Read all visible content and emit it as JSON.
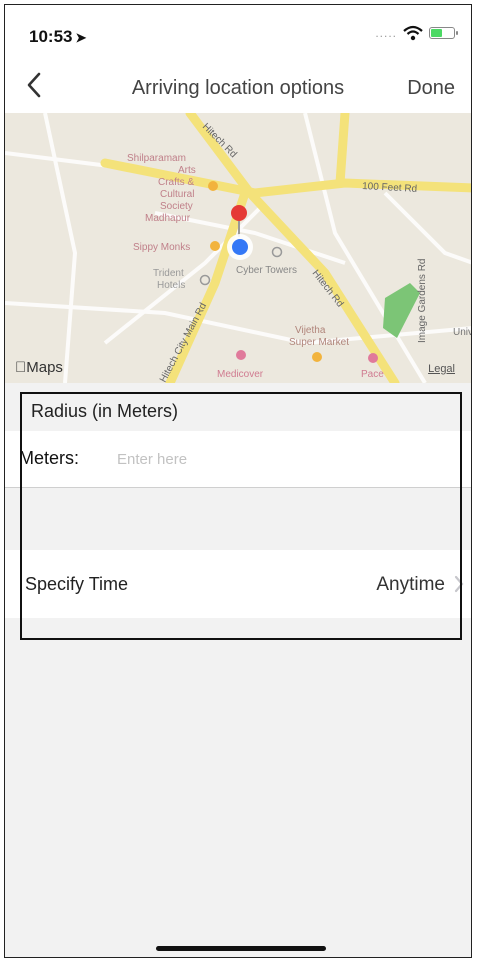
{
  "status": {
    "time": "10:53",
    "dots": "....."
  },
  "nav": {
    "title": "Arriving location options",
    "done": "Done"
  },
  "map": {
    "labels": {
      "shilparamam": [
        "Shilparamam",
        "Arts",
        "Crafts &",
        "Cultural",
        "Society",
        "Madhapur"
      ],
      "hitech_top": "Hitech Rd",
      "feet_rd": "100 Feet Rd",
      "sippy": "Sippy Monks",
      "trident": [
        "Trident",
        "Hotels"
      ],
      "cyber": "Cyber Towers",
      "hitech_right": "Hitech Rd",
      "image_gardens": "Image Gardens Rd",
      "hitech_city": "Hitech City Main Rd",
      "vijetha": [
        "Vijetha",
        "Super Market"
      ],
      "medicover": "Medicover",
      "pace": "Pace",
      "univ": "Univ"
    },
    "logo": "Maps",
    "legal": "Legal"
  },
  "radius": {
    "header": "Radius (in Meters)",
    "label": "Meters:",
    "placeholder": "Enter here"
  },
  "time": {
    "label": "Specify Time",
    "value": "Anytime"
  },
  "colors": {
    "pin": "#e53935",
    "location_dot": "#3478f6",
    "park": "#7cc576",
    "road_major": "#f4e27a"
  }
}
